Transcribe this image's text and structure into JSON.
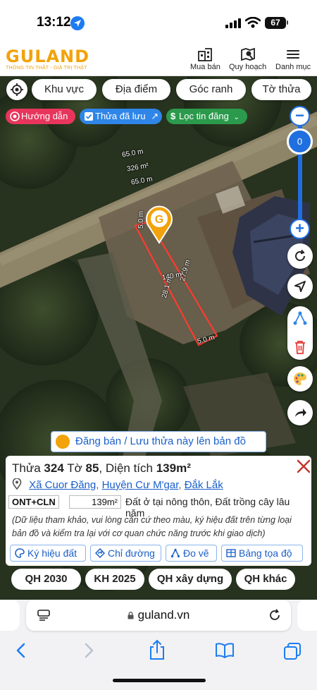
{
  "status": {
    "time": "13:12",
    "battery": "67"
  },
  "brand": {
    "name": "GULAND",
    "tagline": "THÔNG TIN THẬT - GIÁ TRỊ THẬT",
    "accent": "#f2a20a"
  },
  "header_nav": [
    {
      "label": "Mua bán",
      "icon": "building-icon"
    },
    {
      "label": "Quy hoạch",
      "icon": "map-search-icon"
    },
    {
      "label": "Danh mục",
      "icon": "menu-icon"
    }
  ],
  "search_pills": [
    "Khu vực",
    "Địa điểm",
    "Góc ranh",
    "Tờ thửa"
  ],
  "chips": {
    "guide": "Hướng dẫn",
    "saved": "Thửa đã lưu",
    "filter": "Lọc tin đăng"
  },
  "map": {
    "zoom_level": "0",
    "road_labels": [
      "65.0 m",
      "326 m²",
      "65.0 m"
    ],
    "parcel_labels": {
      "top": "5.0 m",
      "side": "27.9 m",
      "area": "140 m²",
      "inner": "28.1 m",
      "bottom": "5.0 m"
    }
  },
  "post_banner": "Đăng bán / Lưu thửa này lên bản đồ",
  "parcel": {
    "thua_label": "Thửa",
    "thua": "324",
    "to_label": "Tờ",
    "to": "85",
    "area_label": "Diện tích",
    "area": "139m²",
    "address": {
      "commune": "Xã Cuor Đăng",
      "district": "Huyện Cư M'gar",
      "province": "Đắk Lắk"
    },
    "land_type": "ONT+CLN",
    "land_area": "139m²",
    "land_desc": "Đất ở tại nông thôn, Đất trồng cây lâu năm",
    "note": "(Dữ liệu tham khảo, vui lòng căn cứ theo màu, ký hiệu đất trên từng loại bản đồ và kiểm tra lại với cơ quan chức năng trước khi giao dịch)"
  },
  "card_actions": [
    "Ký hiệu đất",
    "Chỉ đường",
    "Đo vẽ",
    "Bảng tọa độ"
  ],
  "plans": [
    "QH 2030",
    "KH 2025",
    "QH xây dựng",
    "QH khác"
  ],
  "browser": {
    "url": "guland.vn"
  }
}
